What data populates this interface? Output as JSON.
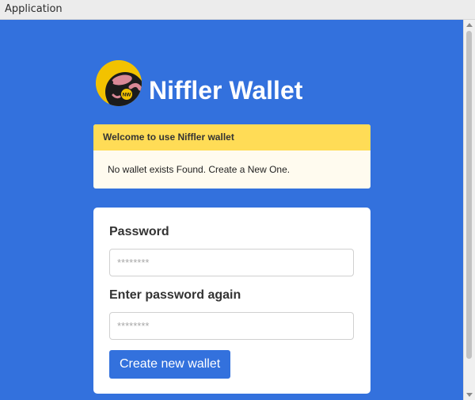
{
  "window": {
    "title": "Application"
  },
  "brand": {
    "name": "Niffler Wallet",
    "logo_badge": "NW"
  },
  "notice": {
    "title": "Welcome to use Niffler wallet",
    "message": "No wallet exists Found. Create a New One."
  },
  "form": {
    "password_label": "Password",
    "password_placeholder": "********",
    "confirm_label": "Enter password again",
    "confirm_placeholder": "********",
    "submit_label": "Create new wallet"
  },
  "colors": {
    "background": "#3371dd",
    "notice_header": "#ffdc56",
    "notice_body": "#fffbef",
    "button": "#3371dd",
    "logo": "#f2c200"
  }
}
